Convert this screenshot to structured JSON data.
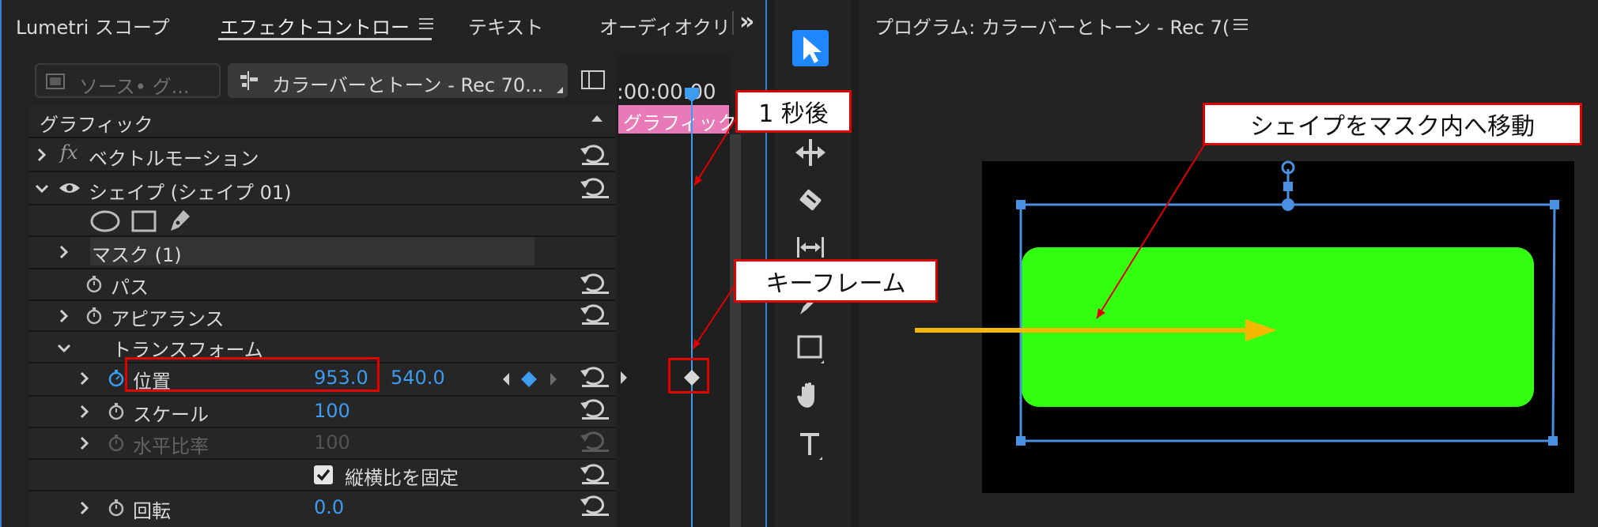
{
  "tabs": {
    "lumetri": "Lumetri スコープ",
    "effect_controls": "エフェクトコントロール",
    "text": "テキスト",
    "audio": "オーディオクリ",
    "overflow": "»"
  },
  "source": {
    "source_placeholder": "ソース• グ...",
    "clip_name": "カラーバーとトーン - Rec 70..."
  },
  "timeline": {
    "timecode": ":00:00:00",
    "clip_label": "グラフィック"
  },
  "effects": {
    "section": "グラフィック",
    "vector_motion": "ベクトルモーション",
    "shape": "シェイプ (シェイプ 01)",
    "mask": "マスク (1)",
    "path": "パス",
    "appearance": "アピアランス",
    "transform": "トランスフォーム",
    "position": {
      "label": "位置",
      "x": "953.0",
      "y": "540.0"
    },
    "scale": {
      "label": "スケール",
      "value": "100"
    },
    "h_ratio": {
      "label": "水平比率",
      "value": "100"
    },
    "lock_ratio": "縦横比を固定",
    "rotation": {
      "label": "回転",
      "value": "0.0"
    }
  },
  "program": {
    "title": "プログラム: カラーバーとトーン - Rec 7("
  },
  "callouts": {
    "one_second": "1 秒後",
    "keyframe": "キーフレーム",
    "move_shape": "シェイプをマスク内へ移動"
  },
  "colors": {
    "accent_blue": "#3d9bf0",
    "shape_green": "#33ff11",
    "motion_arrow": "#f5b800",
    "callout_border": "#e00000",
    "clip_pink": "#e87ab8"
  },
  "icons": [
    "hamburger-icon",
    "clip-icon",
    "selection-icon",
    "track-select-icon",
    "ripple-edit-icon",
    "razor-icon",
    "slip-icon",
    "pen-icon",
    "rectangle-icon",
    "hand-icon",
    "type-icon",
    "stopwatch-icon",
    "reset-icon",
    "fx-icon",
    "eye-icon",
    "ellipse-icon",
    "keyframe-diamond-icon"
  ]
}
